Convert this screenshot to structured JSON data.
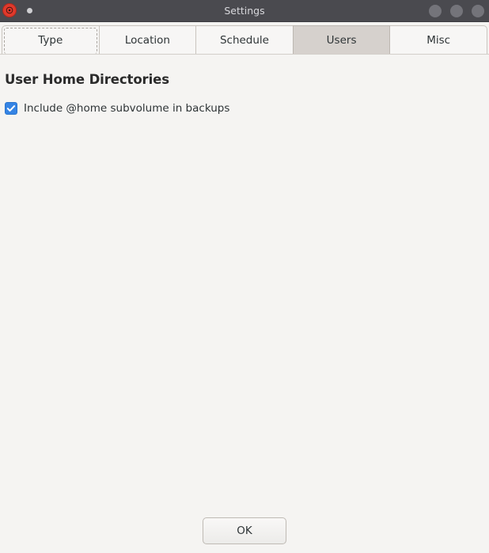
{
  "window": {
    "title": "Settings",
    "app_icon": "app-icon-red",
    "titlebar_bg": "#4a4a4f",
    "title_color": "#d8d8dc",
    "controls": [
      {
        "name": "minimize-button",
        "icon": "circle-icon"
      },
      {
        "name": "maximize-button",
        "icon": "circle-icon"
      },
      {
        "name": "close-button",
        "icon": "circle-icon"
      }
    ]
  },
  "tabs": [
    {
      "label": "Type",
      "selected": false,
      "focused": true
    },
    {
      "label": "Location",
      "selected": false,
      "focused": false
    },
    {
      "label": "Schedule",
      "selected": false,
      "focused": false
    },
    {
      "label": "Users",
      "selected": true,
      "focused": false
    },
    {
      "label": "Misc",
      "selected": false,
      "focused": false
    }
  ],
  "main": {
    "heading": "User Home Directories",
    "checkbox": {
      "label": "Include @home subvolume in backups",
      "checked": true,
      "accent_color": "#3584e4"
    }
  },
  "footer": {
    "ok_label": "OK"
  },
  "colors": {
    "background": "#f5f4f2",
    "tab_unselected": "#f7f6f5",
    "tab_selected": "#d6d1cd",
    "border": "#c9c4be",
    "text": "#2e3436",
    "heading_text": "#2b2b2b"
  }
}
